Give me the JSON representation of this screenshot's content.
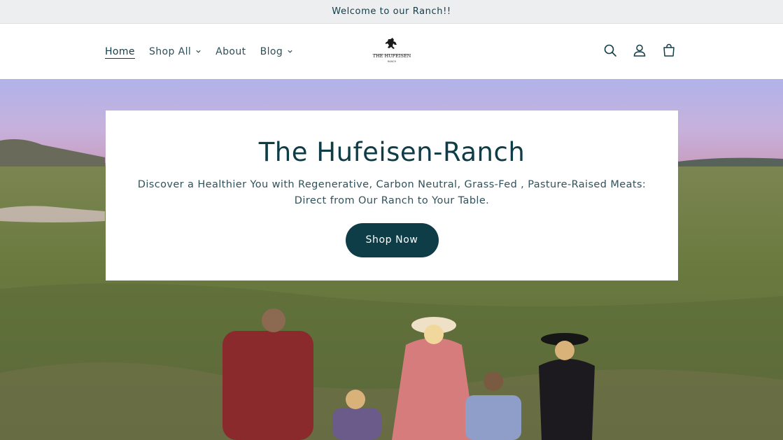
{
  "announcement": {
    "text": "Welcome to our Ranch!!"
  },
  "nav": {
    "items": [
      {
        "label": "Home",
        "active": true,
        "dropdown": false
      },
      {
        "label": "Shop All",
        "active": false,
        "dropdown": true
      },
      {
        "label": "About",
        "active": false,
        "dropdown": false
      },
      {
        "label": "Blog",
        "active": false,
        "dropdown": true
      }
    ]
  },
  "logo": {
    "icon": "bucking-horse-rider-icon",
    "text": "THE HUFEISEN",
    "subtext": "RANCH"
  },
  "header_icons": [
    "search-icon",
    "account-icon",
    "cart-icon"
  ],
  "hero": {
    "title": "The Hufeisen-Ranch",
    "subtitle": "Discover a Healthier You with Regenerative, Carbon Neutral, Grass-Fed , Pasture-Raised Meats: Direct from Our Ranch to Your Table.",
    "button_label": "Shop Now"
  },
  "colors": {
    "brand": "#0e3c47",
    "announcement_bg": "#eceef0"
  }
}
